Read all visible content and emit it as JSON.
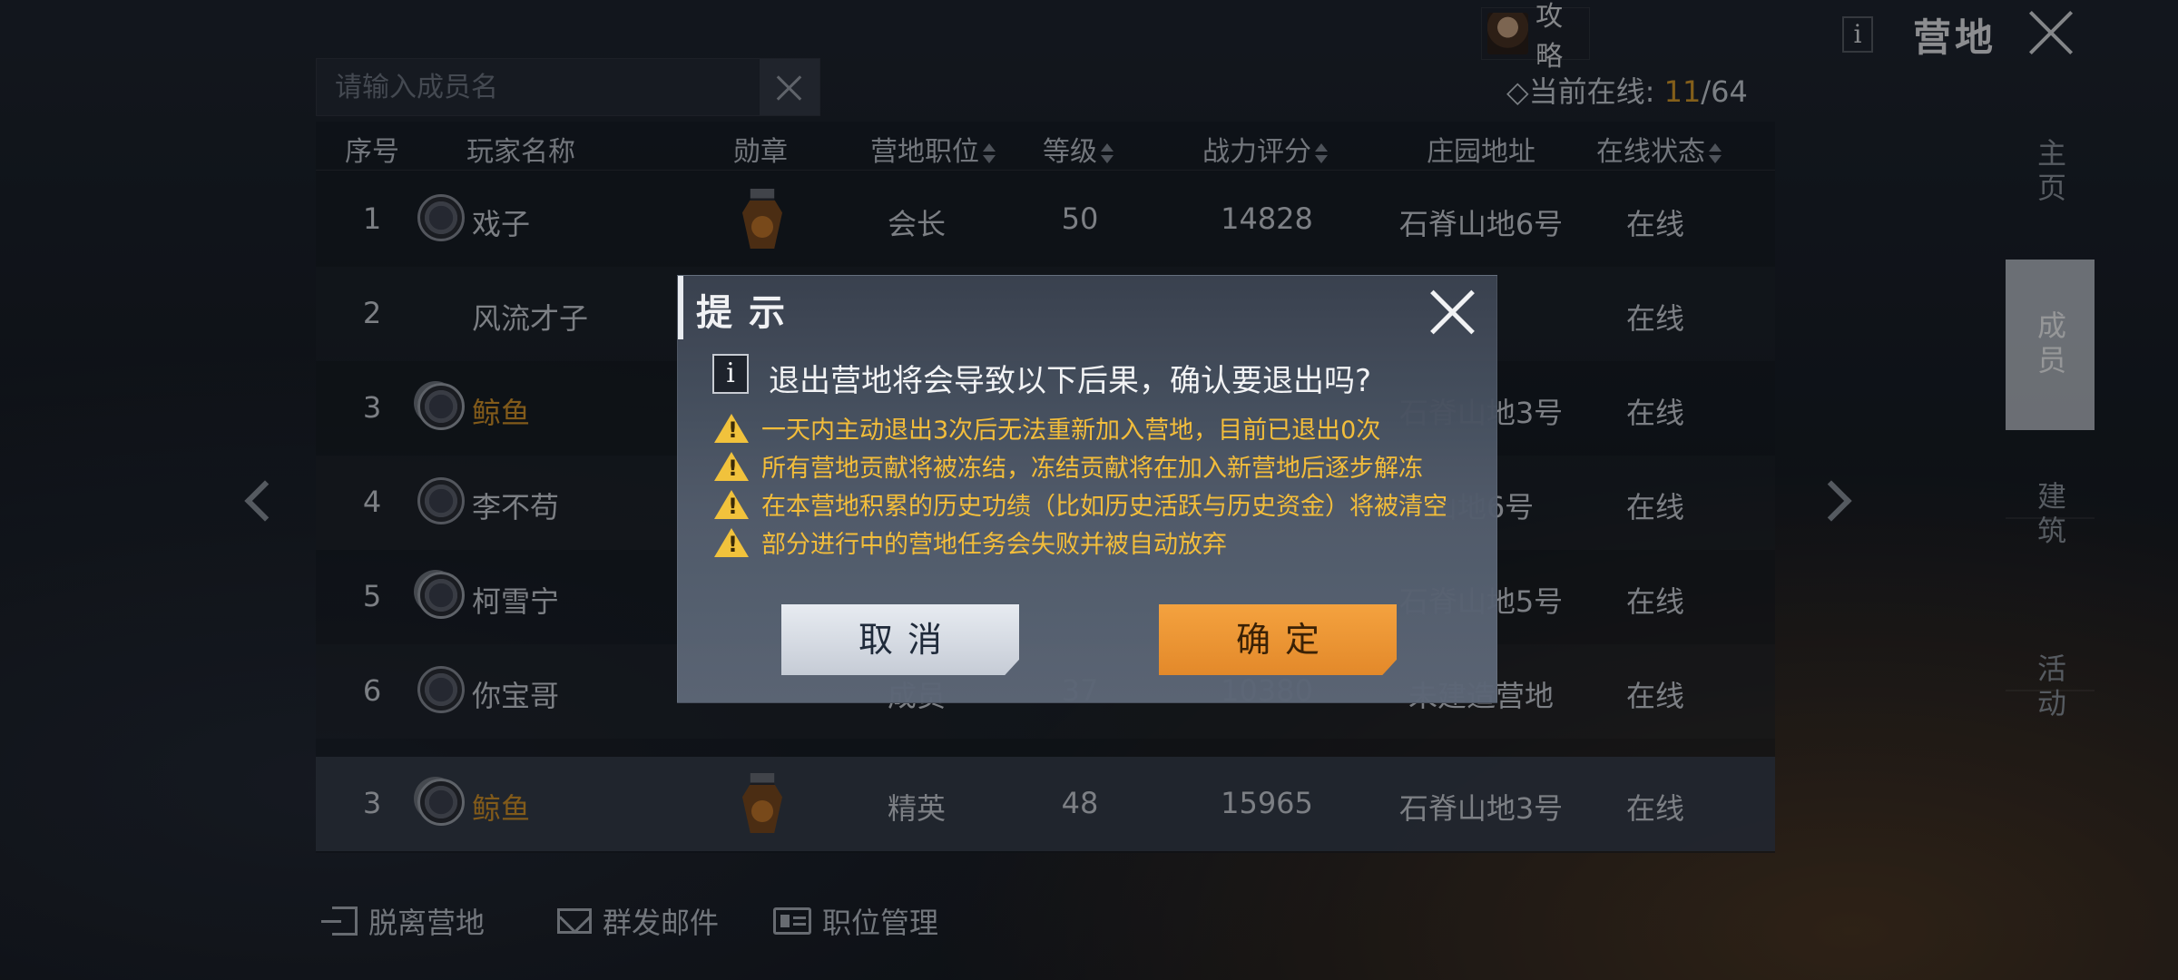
{
  "topbar": {
    "guide_label": "攻略",
    "info_icon": "i",
    "page_title": "营地",
    "close_icon": "close-icon"
  },
  "search": {
    "placeholder": "请输入成员名"
  },
  "online": {
    "label": "◇当前在线:",
    "current": "11",
    "total": "/64"
  },
  "table": {
    "headers": [
      "序号",
      "玩家名称",
      "勋章",
      "营地职位",
      "等级",
      "战力评分",
      "庄园地址",
      "在线状态"
    ],
    "rows": [
      {
        "no": "1",
        "name": "戏子",
        "position": "会长",
        "level": "50",
        "power": "14828",
        "address": "石脊山地6号",
        "status": "在线"
      },
      {
        "no": "2",
        "name": "风流才子",
        "position": "",
        "level": "",
        "power": "",
        "address": "",
        "status": "在线"
      },
      {
        "no": "3",
        "name": "鲸鱼",
        "position": "",
        "level": "",
        "power": "",
        "address": "石脊山地3号",
        "status": "在线"
      },
      {
        "no": "4",
        "name": "李不苟",
        "position": "",
        "level": "",
        "power": "",
        "address": "山地6号",
        "status": "在线"
      },
      {
        "no": "5",
        "name": "柯雪宁",
        "position": "",
        "level": "",
        "power": "",
        "address": "石脊山地5号",
        "status": "在线"
      },
      {
        "no": "6",
        "name": "你宝哥",
        "position": "成员",
        "level": "37",
        "power": "10380",
        "address": "未建造营地",
        "status": "在线"
      }
    ],
    "self_row": {
      "no": "3",
      "name": "鲸鱼",
      "position": "精英",
      "level": "48",
      "power": "15965",
      "address": "石脊山地3号",
      "status": "在线"
    }
  },
  "side_nav": [
    {
      "label": "主页"
    },
    {
      "label": "成员"
    },
    {
      "label": "建筑"
    },
    {
      "label": "活动"
    }
  ],
  "actions": {
    "leave": "脱离营地",
    "mail": "群发邮件",
    "roles": "职位管理"
  },
  "dialog": {
    "title": "提示",
    "info_icon": "i",
    "question": "退出营地将会导致以下后果，确认要退出吗?",
    "warnings": [
      "一天内主动退出3次后无法重新加入营地，目前已退出0次",
      "所有营地贡献将被冻结，冻结贡献将在加入新营地后逐步解冻",
      "在本营地积累的历史功绩（比如历史活跃与历史资金）将被清空",
      "部分进行中的营地任务会失败并被自动放弃"
    ],
    "cancel_label": "取消",
    "confirm_label": "确定"
  },
  "colors": {
    "accent_orange": "#e3892a",
    "warning_yellow": "#f3bd3b",
    "gold_name": "#d0922a"
  }
}
